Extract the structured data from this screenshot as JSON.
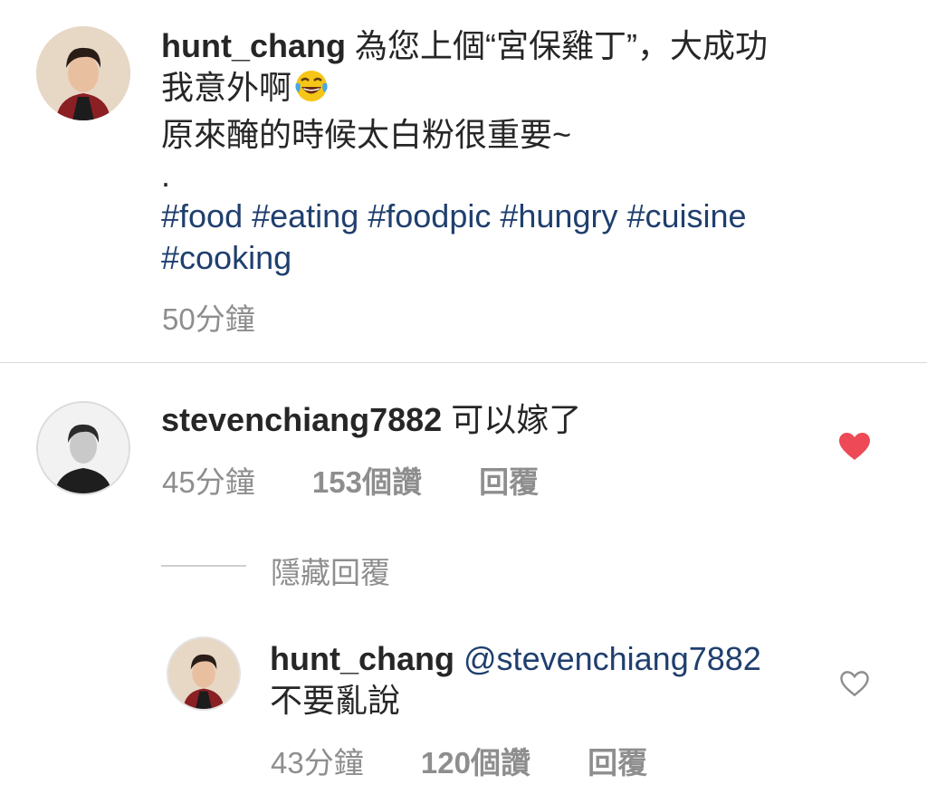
{
  "post": {
    "username": "hunt_chang",
    "caption_line1": "為您上個“宮保雞丁”，大成功",
    "caption_line2": "我意外啊",
    "caption_emoji": "laughing-tears-emoji",
    "caption_line3": "原來醃的時候太白粉很重要~",
    "caption_dot": ".",
    "hashtags": [
      "#food",
      "#eating",
      "#foodpic",
      "#hungry",
      "#cuisine",
      "#cooking"
    ],
    "time": "50分鐘"
  },
  "comment": {
    "username": "stevenchiang7882",
    "text": "可以嫁了",
    "time": "45分鐘",
    "likes": "153個讚",
    "reply_label": "回覆",
    "liked": true,
    "heart_color": "#ed4956"
  },
  "hide_replies_label": "隱藏回覆",
  "reply": {
    "username": "hunt_chang",
    "mention": "@stevenchiang7882",
    "text": "不要亂說",
    "time": "43分鐘",
    "likes": "120個讚",
    "reply_label": "回覆",
    "liked": false
  }
}
